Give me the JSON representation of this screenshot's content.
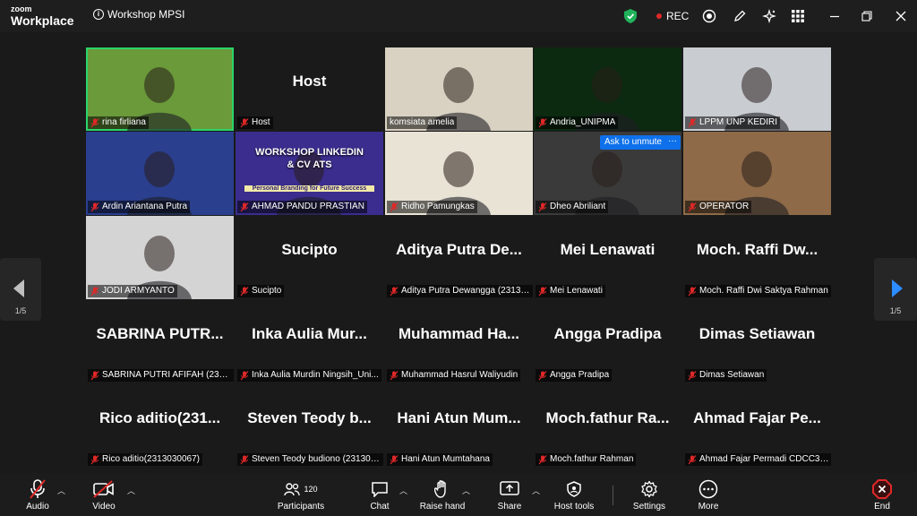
{
  "app": {
    "brand_top": "zoom",
    "brand_bottom": "Workplace",
    "meeting_title": "Workshop MPSI",
    "rec_label": "REC"
  },
  "pagination": {
    "left": "1/5",
    "right": "1/5"
  },
  "tiles": [
    {
      "name": "rina firliana",
      "type": "video",
      "bg": "#6a9a3a"
    },
    {
      "name": "Host",
      "type": "name",
      "big": "Host"
    },
    {
      "name": "komsiata amelia",
      "type": "video",
      "bg": "#d9d2c2"
    },
    {
      "name": "Andria_UNIPMA",
      "type": "video",
      "bg": "#0c2a10"
    },
    {
      "name": "LPPM UNP KEDIRI",
      "type": "video",
      "bg": "#c9cdd2"
    },
    {
      "name": "Ardin Ariantana Putra",
      "type": "video",
      "bg": "#2a3f8e"
    },
    {
      "name": "AHMAD PANDU PRASTIAN",
      "type": "video",
      "bg": "#3a2d8e",
      "poster": "WORKSHOP LINKEDIN & CV ATS",
      "poster_sub": "Personal Branding for Future Success"
    },
    {
      "name": "Ridho Pamungkas",
      "type": "video",
      "bg": "#e9e3d6"
    },
    {
      "name": "Dheo Abriliant",
      "type": "video",
      "bg": "#3a3a3a"
    },
    {
      "name": "OPERATOR",
      "type": "video",
      "bg": "#8e6a48"
    },
    {
      "name": "JODI ARMYANTO",
      "type": "video",
      "bg": "#d4d4d4"
    },
    {
      "name": "Sucipto",
      "type": "name",
      "big": "Sucipto"
    },
    {
      "name": "Aditya Putra Dewangga (23130...",
      "type": "name",
      "big": "Aditya Putra De..."
    },
    {
      "name": "Mei Lenawati",
      "type": "name",
      "big": "Mei Lenawati"
    },
    {
      "name": "Moch. Raffi Dwi Saktya Rahman",
      "type": "name",
      "big": "Moch. Raffi Dw..."
    },
    {
      "name": "SABRINA PUTRI AFIFAH (23130...",
      "type": "name",
      "big": "SABRINA PUTR..."
    },
    {
      "name": "Inka Aulia Murdin Ningsih_Uni...",
      "type": "name",
      "big": "Inka Aulia Mur..."
    },
    {
      "name": "Muhammad Hasrul Waliyudin",
      "type": "name",
      "big": "Muhammad Ha..."
    },
    {
      "name": "Angga Pradipa",
      "type": "name",
      "big": "Angga Pradipa"
    },
    {
      "name": "Dimas Setiawan",
      "type": "name",
      "big": "Dimas Setiawan"
    },
    {
      "name": "Rico aditio(2313030067)",
      "type": "name",
      "big": "Rico aditio(231..."
    },
    {
      "name": "Steven Teody budiono (231303...",
      "type": "name",
      "big": "Steven Teody b..."
    },
    {
      "name": "Hani Atun Mumtahana",
      "type": "name",
      "big": "Hani Atun Mum..."
    },
    {
      "name": "Moch.fathur Rahman",
      "type": "name",
      "big": "Moch.fathur Ra..."
    },
    {
      "name": "Ahmad Fajar Permadi CDCC358...",
      "type": "name",
      "big": "Ahmad Fajar Pe..."
    }
  ],
  "popover": {
    "unmute_label": "Ask to unmute",
    "more_label": "···"
  },
  "toolbar": {
    "audio": "Audio",
    "video": "Video",
    "participants": "Participants",
    "participants_count": "120",
    "chat": "Chat",
    "raise_hand": "Raise hand",
    "share": "Share",
    "host_tools": "Host tools",
    "settings": "Settings",
    "more": "More",
    "end": "End"
  },
  "colors": {
    "accent": "#0e71eb",
    "shield": "#1fb25a",
    "muted": "#e02828",
    "end": "#e02828",
    "active_border": "#2bd46a"
  }
}
